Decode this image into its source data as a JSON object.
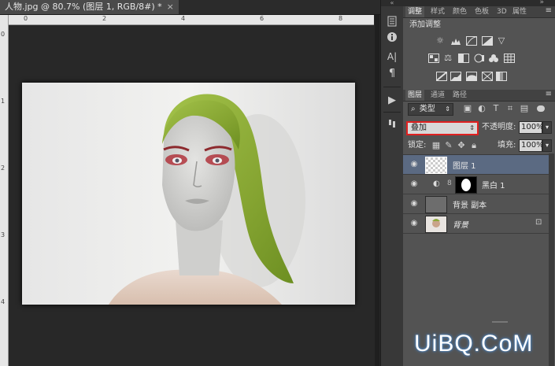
{
  "document": {
    "tab_title": "人物.jpg @ 80.7% (图层 1, RGB/8#) *",
    "close_glyph": "×"
  },
  "rulers": {
    "top_labels": [
      "0",
      "2",
      "4",
      "6",
      "8"
    ],
    "left_labels": [
      "0",
      "1",
      "2",
      "3",
      "4"
    ]
  },
  "side_icons": [
    "history-icon",
    "info-icon",
    "character-icon",
    "paragraph-icon",
    "play-icon",
    "tool-presets-icon"
  ],
  "adjust_panel": {
    "tabs": [
      "调整",
      "样式",
      "颜色",
      "色板",
      "3D",
      "属性"
    ],
    "active_tab": "调整",
    "title": "添加调整",
    "row1": [
      "brightness-icon",
      "levels-icon",
      "curves-icon",
      "exposure-icon",
      "vibrance-icon"
    ],
    "row2": [
      "hue-saturation-icon",
      "color-balance-icon",
      "black-white-icon",
      "photo-filter-icon",
      "channel-mixer-icon",
      "color-lookup-icon"
    ],
    "row3": [
      "invert-icon",
      "posterize-icon",
      "threshold-icon",
      "selective-color-icon",
      "gradient-map-icon"
    ]
  },
  "layers_panel": {
    "tabs": [
      "图层",
      "通道",
      "路径"
    ],
    "active_tab": "图层",
    "filter_kind": "类型",
    "blend_mode": "叠加",
    "opacity_label": "不透明度:",
    "opacity_value": "100%",
    "lock_label": "锁定:",
    "fill_label": "填充:",
    "fill_value": "100%",
    "layers": [
      {
        "name": "图层 1",
        "selected": true,
        "type": "transparent"
      },
      {
        "name": "黑白 1",
        "selected": false,
        "type": "adjustment"
      },
      {
        "name": "背景 副本",
        "selected": false,
        "type": "gray"
      },
      {
        "name": "背景",
        "selected": false,
        "type": "photo",
        "locked": true
      }
    ]
  },
  "watermark": "UiBQ.CoM",
  "colors": {
    "highlight_border": "#e02020",
    "selected_layer": "#5b6a82",
    "hair": "#8fb23a",
    "panel_bg": "#535353"
  }
}
